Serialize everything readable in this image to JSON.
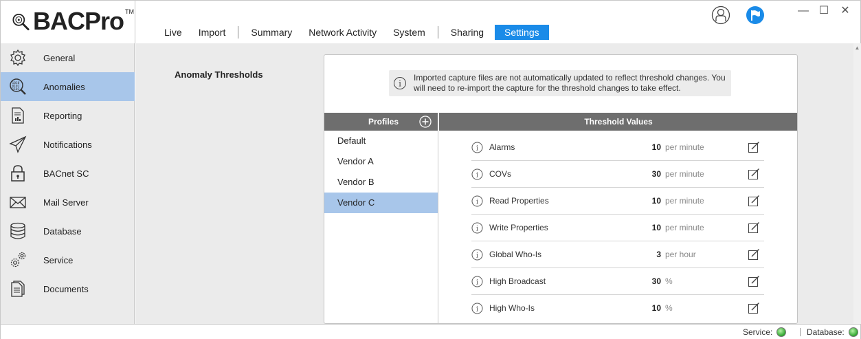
{
  "app": {
    "logo_text": "BACPro",
    "logo_tm": "TM"
  },
  "tabs": [
    {
      "label": "Live"
    },
    {
      "label": "Import"
    },
    {
      "label": "Summary"
    },
    {
      "label": "Network Activity"
    },
    {
      "label": "System"
    },
    {
      "label": "Sharing"
    },
    {
      "label": "Settings",
      "active": true
    }
  ],
  "sidebar": {
    "items": [
      {
        "label": "General",
        "icon": "gear-icon"
      },
      {
        "label": "Anomalies",
        "icon": "binary-magnifier-icon",
        "active": true
      },
      {
        "label": "Reporting",
        "icon": "report-icon"
      },
      {
        "label": "Notifications",
        "icon": "paper-plane-icon"
      },
      {
        "label": "BACnet SC",
        "icon": "lock-icon"
      },
      {
        "label": "Mail Server",
        "icon": "envelope-icon"
      },
      {
        "label": "Database",
        "icon": "database-icon"
      },
      {
        "label": "Service",
        "icon": "gears-icon"
      },
      {
        "label": "Documents",
        "icon": "documents-icon"
      }
    ]
  },
  "main": {
    "section_title": "Anomaly Thresholds",
    "info_text": "Imported capture files are not automatically updated to reflect threshold changes. You will need to re-import the capture for the threshold changes to take effect.",
    "profiles_header": "Profiles",
    "values_header": "Threshold Values",
    "profiles": [
      {
        "label": "Default"
      },
      {
        "label": "Vendor A"
      },
      {
        "label": "Vendor B"
      },
      {
        "label": "Vendor C",
        "active": true
      }
    ],
    "thresholds": [
      {
        "label": "Alarms",
        "value": "10",
        "unit": "per minute"
      },
      {
        "label": "COVs",
        "value": "30",
        "unit": "per minute"
      },
      {
        "label": "Read Properties",
        "value": "10",
        "unit": "per minute"
      },
      {
        "label": "Write Properties",
        "value": "10",
        "unit": "per minute"
      },
      {
        "label": "Global Who-Is",
        "value": "3",
        "unit": "per hour"
      },
      {
        "label": "High Broadcast",
        "value": "30",
        "unit": "%"
      },
      {
        "label": "High Who-Is",
        "value": "10",
        "unit": "%"
      }
    ]
  },
  "status": {
    "service_label": "Service:",
    "database_label": "Database:",
    "service_color": "#2fa52f",
    "database_color": "#2fa52f"
  },
  "colors": {
    "accent": "#1a8be8",
    "selection": "#a8c6ea",
    "header_bar": "#6e6e6e"
  }
}
